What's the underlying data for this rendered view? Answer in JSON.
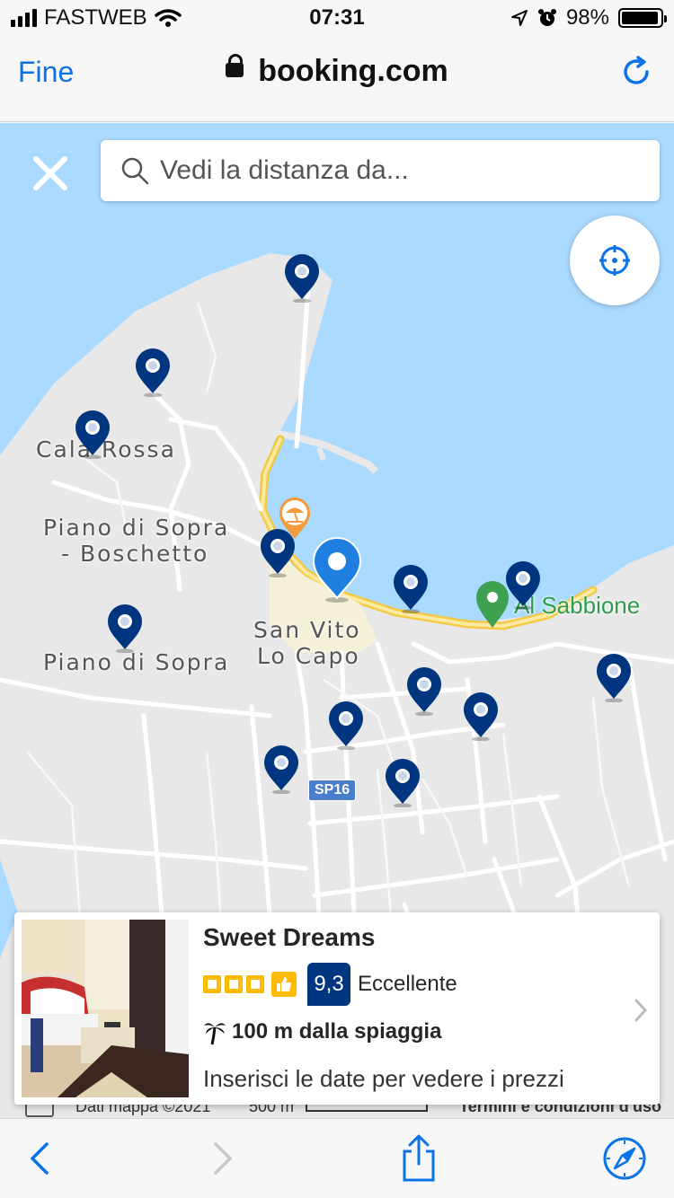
{
  "status_bar": {
    "carrier": "FASTWEB",
    "time": "07:31",
    "battery": "98%",
    "battery_level": 0.98
  },
  "browser": {
    "done_label": "Fine",
    "url": "booking.com"
  },
  "search": {
    "placeholder": "Vedi la distanza da..."
  },
  "map": {
    "labels": {
      "cala_rossa": "Cala Rossa",
      "piano_boschetto_1": "Piano di Sopra",
      "piano_boschetto_2": "- Boschetto",
      "piano_di_sopra": "Piano di Sopra",
      "san_vito_1": "San Vito",
      "san_vito_2": "Lo Capo",
      "al_sabbione": "Al Sabbione",
      "road": "SP16"
    },
    "attribution": "Dati mappa ©2021",
    "scale": "500 m",
    "terms": "Termini e condizioni d'uso"
  },
  "hotel": {
    "name": "Sweet Dreams",
    "stars": 3,
    "score": "9,3",
    "score_word": "Eccellente",
    "distance": "100 m dalla spiaggia",
    "dates_hint": "Inserisci le date per vedere i prezzi"
  },
  "colors": {
    "accent": "#0a73e8",
    "pin": "#003580",
    "pin_selected": "#1f7fe0",
    "star": "#febb02",
    "sea": "#aadaff",
    "land": "#e8e8e8",
    "beach": "#f3c945"
  },
  "icons": [
    "close-icon",
    "search-icon",
    "crosshair-icon",
    "map-pin-icon",
    "beach-umbrella-icon",
    "palm-tree-icon",
    "thumbs-up-icon",
    "chevron-right-icon",
    "back-icon",
    "forward-icon",
    "share-icon",
    "compass-icon",
    "lock-icon",
    "reload-icon",
    "wifi-icon",
    "alarm-icon",
    "location-arrow-icon",
    "keyboard-icon"
  ]
}
